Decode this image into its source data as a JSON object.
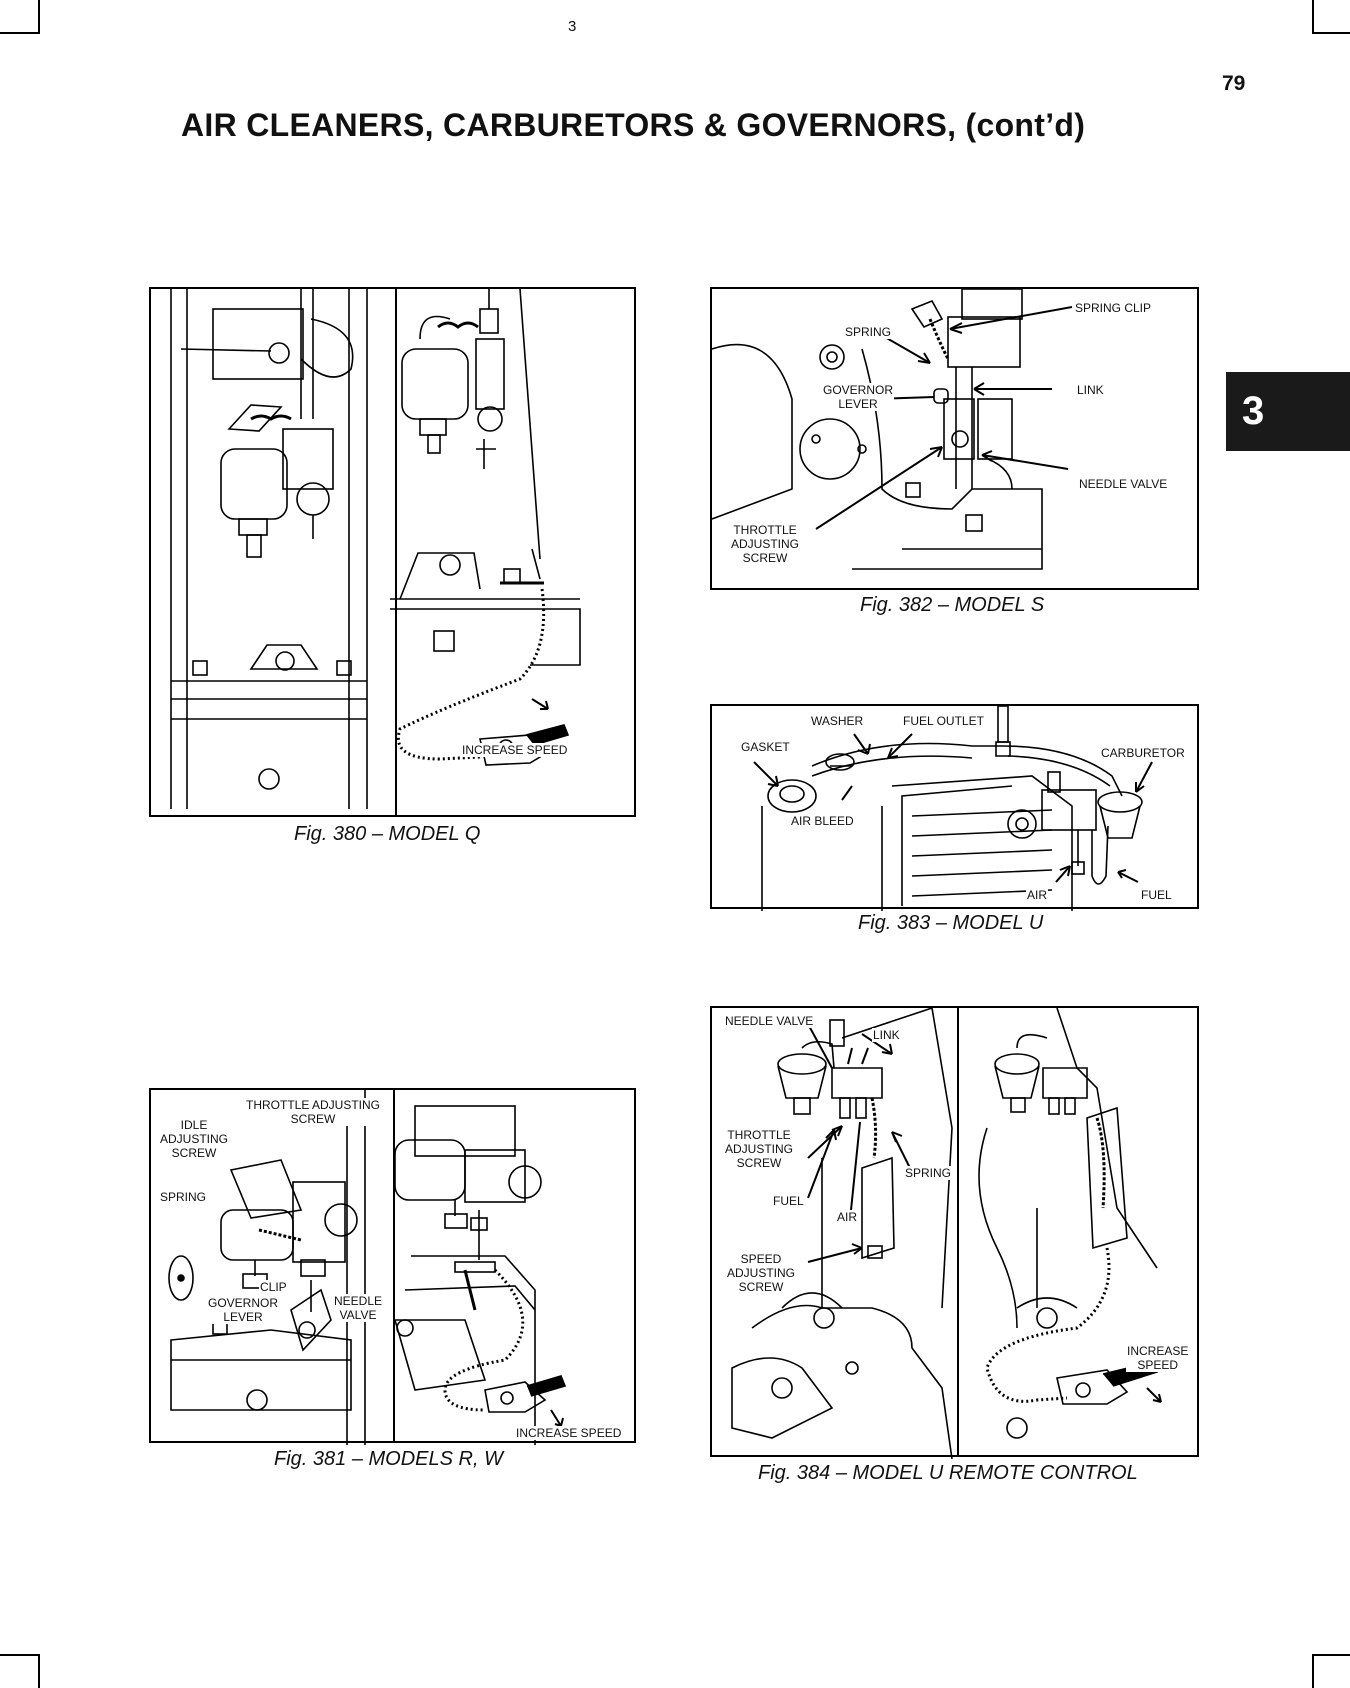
{
  "header": {
    "top_number": "3",
    "page_number": "79",
    "chapter_tab": "3"
  },
  "title": "AIR CLEANERS, CARBURETORS & GOVERNORS, (cont’d)",
  "figures": {
    "fig380": {
      "caption": "Fig. 380 – MODEL Q",
      "labels": {
        "increase_speed": "INCREASE SPEED"
      }
    },
    "fig381": {
      "caption": "Fig. 381 – MODELS R, W",
      "labels": {
        "throttle_adjusting_screw": "THROTTLE ADJUSTING\nSCREW",
        "idle_adjusting_screw": "IDLE\nADJUSTING\nSCREW",
        "spring": "SPRING",
        "clip": "CLIP",
        "governor_lever": "GOVERNOR\nLEVER",
        "needle_valve": "NEEDLE\nVALVE",
        "increase_speed": "INCREASE SPEED"
      }
    },
    "fig382": {
      "caption": "Fig. 382 – MODEL S",
      "labels": {
        "spring_clip": "SPRING CLIP",
        "spring": "SPRING",
        "governor_lever": "GOVERNOR\nLEVER",
        "link": "LINK",
        "needle_valve": "NEEDLE VALVE",
        "throttle_adjusting_screw": "THROTTLE\nADJUSTING\nSCREW"
      }
    },
    "fig383": {
      "caption": "Fig. 383 – MODEL U",
      "labels": {
        "washer": "WASHER",
        "fuel_outlet": "FUEL OUTLET",
        "gasket": "GASKET",
        "carburetor": "CARBURETOR",
        "air_bleed": "AIR BLEED",
        "air": "AIR",
        "fuel": "FUEL"
      }
    },
    "fig384": {
      "caption": "Fig. 384 – MODEL U REMOTE CONTROL",
      "labels": {
        "needle_valve": "NEEDLE VALVE",
        "link": "LINK",
        "throttle_adjusting_screw": "THROTTLE\nADJUSTING\nSCREW",
        "spring": "SPRING",
        "fuel": "FUEL",
        "air": "AIR",
        "speed_adjusting_screw": "SPEED\nADJUSTING\nSCREW",
        "increase_speed": "INCREASE\nSPEED"
      }
    }
  }
}
